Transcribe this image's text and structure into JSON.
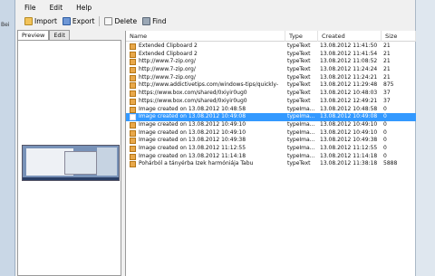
{
  "background": {
    "left_stub": "Bei"
  },
  "menu": {
    "file": "File",
    "edit": "Edit",
    "help": "Help"
  },
  "toolbar": {
    "import": "Import",
    "export": "Export",
    "delete": "Delete",
    "find": "Find"
  },
  "tabs": {
    "preview": "Preview",
    "edit": "Edit"
  },
  "columns": {
    "name": "Name",
    "type": "Type",
    "created": "Created",
    "size": "Size"
  },
  "rows": [
    {
      "name": "Extended Clipboard 2",
      "type": "typeText",
      "created": "13.08.2012 11:41:50",
      "size": "21"
    },
    {
      "name": "Extended Clipboard 2",
      "type": "typeText",
      "created": "13.08.2012 11:41:54",
      "size": "21"
    },
    {
      "name": "http://www.7-zip.org/",
      "type": "typeText",
      "created": "13.08.2012 11:08:52",
      "size": "21"
    },
    {
      "name": "http://www.7-zip.org/",
      "type": "typeText",
      "created": "13.08.2012 11:24:24",
      "size": "21"
    },
    {
      "name": "http://www.7-zip.org/",
      "type": "typeText",
      "created": "13.08.2012 11:24:21",
      "size": "21"
    },
    {
      "name": "http://www.addictivetips.com/windows-tips/quickly-",
      "type": "typeText",
      "created": "13.08.2012 11:29:48",
      "size": "875"
    },
    {
      "name": "https://www.box.com/shared/0xiyir0ug0",
      "type": "typeText",
      "created": "13.08.2012 10:48:03",
      "size": "37"
    },
    {
      "name": "https://www.box.com/shared/0xiyir0ug0",
      "type": "typeText",
      "created": "13.08.2012 12:49:21",
      "size": "37"
    },
    {
      "name": "Image created on 13.08.2012 10:48:58",
      "type": "typeIma...",
      "created": "13.08.2012 10:48:58",
      "size": "0"
    },
    {
      "name": "Image created on 13.08.2012 10:49:08",
      "type": "typeIma...",
      "created": "13.08.2012 10:49:08",
      "size": "0"
    },
    {
      "name": "Image created on 13.08.2012 10:49:10",
      "type": "typeIma...",
      "created": "13.08.2012 10:49:10",
      "size": "0"
    },
    {
      "name": "Image created on 13.08.2012 10:49:10",
      "type": "typeIma...",
      "created": "13.08.2012 10:49:10",
      "size": "0"
    },
    {
      "name": "Image created on 13.08.2012 10:49:38",
      "type": "typeIma...",
      "created": "13.08.2012 10:49:38",
      "size": "0"
    },
    {
      "name": "Image created on 13.08.2012 11:12:55",
      "type": "typeIma...",
      "created": "13.08.2012 11:12:55",
      "size": "0"
    },
    {
      "name": "Image created on 13.08.2012 11:14:18",
      "type": "typeIma...",
      "created": "13.08.2012 11:14:18",
      "size": "0"
    },
    {
      "name": "Pohárból a tányérba     Izek harmóniája Tabu",
      "type": "typeText",
      "created": "13.08.2012 11:38:18",
      "size": "5888"
    }
  ],
  "selected_row": 9,
  "colors": {
    "selection": "#3399ff",
    "window_bg": "#f0f0f0",
    "desktop_strip": "#c9d7e6"
  }
}
